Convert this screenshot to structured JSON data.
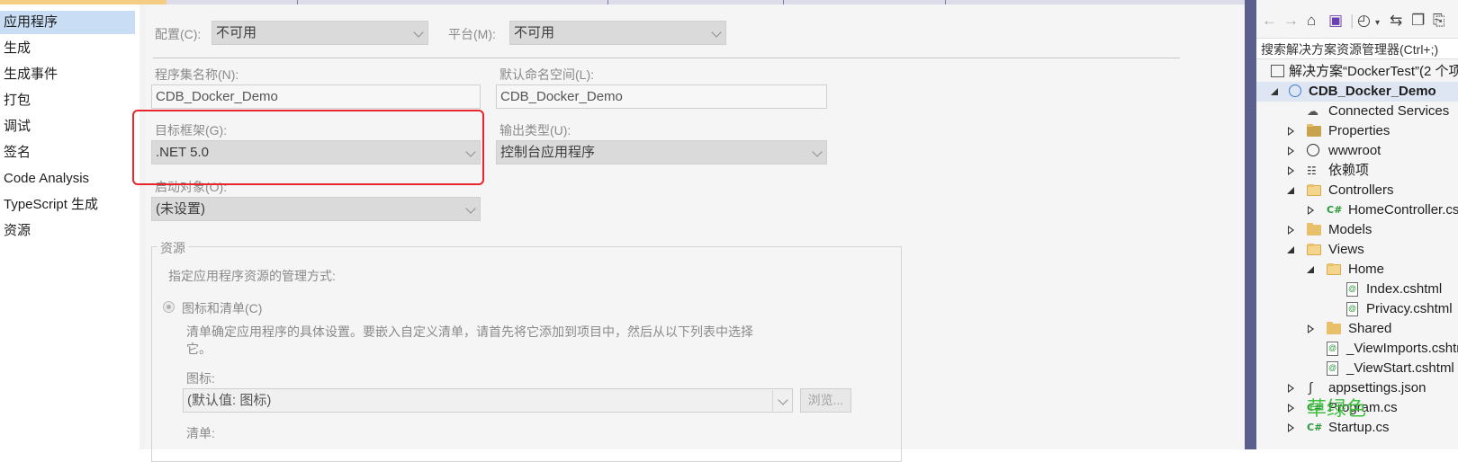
{
  "nav": {
    "items": [
      "应用程序",
      "生成",
      "生成事件",
      "打包",
      "调试",
      "签名",
      "Code Analysis",
      "TypeScript 生成",
      "资源"
    ],
    "selected_index": 0
  },
  "config": {
    "label": "配置(C):",
    "value": "不可用",
    "platform_label": "平台(M):",
    "platform_value": "不可用"
  },
  "app": {
    "assembly_name_label": "程序集名称(N):",
    "assembly_name": "CDB_Docker_Demo",
    "default_namespace_label": "默认命名空间(L):",
    "default_namespace": "CDB_Docker_Demo",
    "target_framework_label": "目标框架(G):",
    "target_framework": ".NET 5.0",
    "output_type_label": "输出类型(U):",
    "output_type": "控制台应用程序",
    "startup_object_label": "启动对象(O):",
    "startup_object": "(未设置)"
  },
  "resources": {
    "group_title": "资源",
    "hint": "指定应用程序资源的管理方式:",
    "radio_label": "图标和清单(C)",
    "description_line1": "清单确定应用程序的具体设置。要嵌入自定义清单，请首先将它添加到项目中，然后从以下列表中选择",
    "description_line2": "它。",
    "icon_label": "图标:",
    "icon_value": "(默认值: 图标)",
    "browse_label": "浏览...",
    "manifest_label": "清单:"
  },
  "solution_explorer": {
    "search_placeholder": "搜索解决方案资源管理器(Ctrl+;)",
    "tree": [
      {
        "label": "解决方案“DockerTest”(2 个项",
        "icon": "solution-icon",
        "level": 0,
        "expander": "none",
        "bold": false
      },
      {
        "label": "CDB_Docker_Demo",
        "icon": "web-project-icon",
        "level": 0,
        "expander": "expanded",
        "bold": true
      },
      {
        "label": "Connected Services",
        "icon": "connected-services-icon",
        "level": 1,
        "expander": "none",
        "bold": false
      },
      {
        "label": "Properties",
        "icon": "properties-icon",
        "level": 1,
        "expander": "collapsed",
        "bold": false
      },
      {
        "label": "wwwroot",
        "icon": "globe-icon",
        "level": 1,
        "expander": "collapsed",
        "bold": false
      },
      {
        "label": "依赖项",
        "icon": "dependencies-icon",
        "level": 1,
        "expander": "collapsed",
        "bold": false
      },
      {
        "label": "Controllers",
        "icon": "folder-open-icon",
        "level": 1,
        "expander": "expanded",
        "bold": false
      },
      {
        "label": "HomeController.cs",
        "icon": "csharp-file-icon",
        "level": 2,
        "expander": "collapsed",
        "bold": false
      },
      {
        "label": "Models",
        "icon": "folder-icon",
        "level": 1,
        "expander": "collapsed",
        "bold": false
      },
      {
        "label": "Views",
        "icon": "folder-open-icon",
        "level": 1,
        "expander": "expanded",
        "bold": false
      },
      {
        "label": "Home",
        "icon": "folder-open-icon",
        "level": 2,
        "expander": "expanded",
        "bold": false
      },
      {
        "label": "Index.cshtml",
        "icon": "razor-file-icon",
        "level": 3,
        "expander": "none",
        "bold": false
      },
      {
        "label": "Privacy.cshtml",
        "icon": "razor-file-icon",
        "level": 3,
        "expander": "none",
        "bold": false
      },
      {
        "label": "Shared",
        "icon": "folder-icon",
        "level": 2,
        "expander": "collapsed",
        "bold": false
      },
      {
        "label": "_ViewImports.cshtml",
        "icon": "razor-file-icon",
        "level": 2,
        "expander": "none",
        "bold": false
      },
      {
        "label": "_ViewStart.cshtml",
        "icon": "razor-file-icon",
        "level": 2,
        "expander": "none",
        "bold": false
      },
      {
        "label": "appsettings.json",
        "icon": "json-file-icon",
        "level": 1,
        "expander": "collapsed",
        "bold": false
      },
      {
        "label": "Program.cs",
        "icon": "csharp-file-icon",
        "level": 1,
        "expander": "collapsed",
        "bold": false
      },
      {
        "label": "Startup.cs",
        "icon": "csharp-file-icon",
        "level": 1,
        "expander": "collapsed",
        "bold": false
      }
    ]
  },
  "watermark": "草绿色",
  "colors": {
    "highlight": "#e8242c",
    "selection": "#c9def5",
    "splitter": "#5a5f8c",
    "watermark": "#3fbf3f"
  }
}
